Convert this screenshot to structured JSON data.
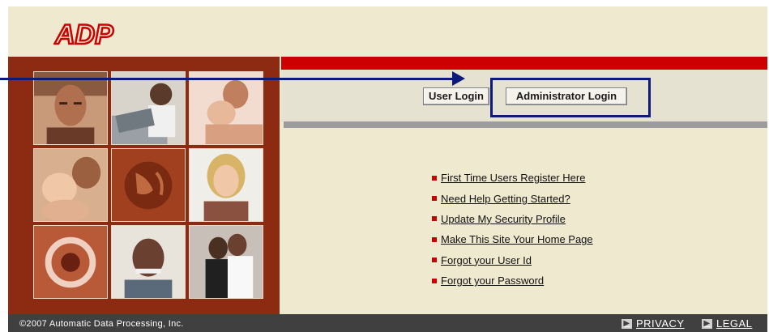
{
  "brand": {
    "logo_text": "ADP"
  },
  "login": {
    "user_login_label": "User Login",
    "admin_login_label": "Administrator Login"
  },
  "links": [
    "First Time Users Register Here",
    "Need Help Getting Started?",
    "Update My Security Profile",
    "Make This Site Your Home Page",
    "Forgot your User Id",
    "Forgot your Password"
  ],
  "footer": {
    "copyright": "©2007 Automatic Data Processing, Inc.",
    "privacy_label": "PRIVACY",
    "legal_label": "LEGAL"
  },
  "colors": {
    "brand_red": "#cc0000",
    "panel_maroon": "#8c2b12",
    "background_cream": "#efe9d0",
    "annotation_blue": "#0e1a7a",
    "footer_gray": "#404040"
  },
  "photos": [
    "man-portrait-photo",
    "laptop-user-photo",
    "couple-photo",
    "baby-and-father-photo",
    "globe-photo",
    "woman-portrait-photo",
    "abstract-photo",
    "older-man-photo",
    "wedding-couple-photo"
  ]
}
